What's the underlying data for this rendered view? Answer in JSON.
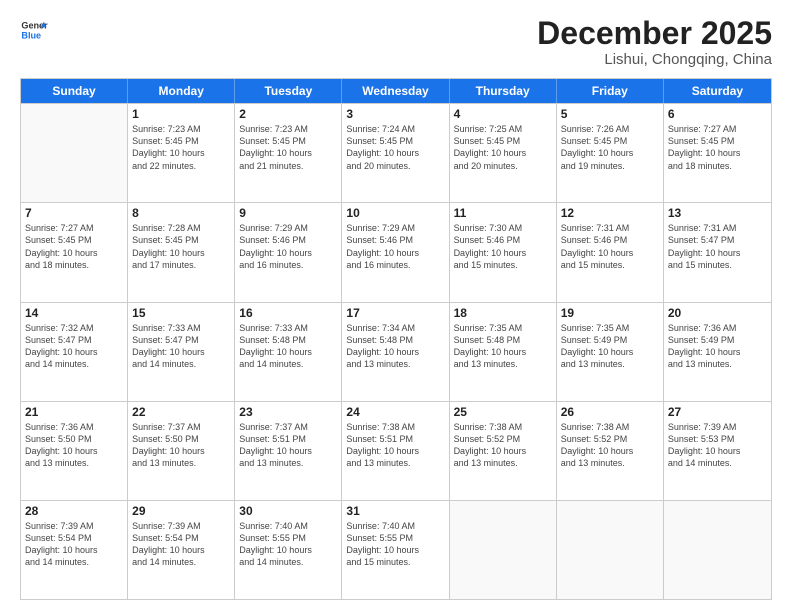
{
  "header": {
    "logo_general": "General",
    "logo_blue": "Blue",
    "month": "December 2025",
    "location": "Lishui, Chongqing, China"
  },
  "weekdays": [
    "Sunday",
    "Monday",
    "Tuesday",
    "Wednesday",
    "Thursday",
    "Friday",
    "Saturday"
  ],
  "rows": [
    [
      {
        "day": "",
        "empty": true
      },
      {
        "day": "1",
        "rise": "7:23 AM",
        "set": "5:45 PM",
        "daylight": "10 hours and 22 minutes."
      },
      {
        "day": "2",
        "rise": "7:23 AM",
        "set": "5:45 PM",
        "daylight": "10 hours and 21 minutes."
      },
      {
        "day": "3",
        "rise": "7:24 AM",
        "set": "5:45 PM",
        "daylight": "10 hours and 20 minutes."
      },
      {
        "day": "4",
        "rise": "7:25 AM",
        "set": "5:45 PM",
        "daylight": "10 hours and 20 minutes."
      },
      {
        "day": "5",
        "rise": "7:26 AM",
        "set": "5:45 PM",
        "daylight": "10 hours and 19 minutes."
      },
      {
        "day": "6",
        "rise": "7:27 AM",
        "set": "5:45 PM",
        "daylight": "10 hours and 18 minutes."
      }
    ],
    [
      {
        "day": "7",
        "rise": "7:27 AM",
        "set": "5:45 PM",
        "daylight": "10 hours and 18 minutes."
      },
      {
        "day": "8",
        "rise": "7:28 AM",
        "set": "5:45 PM",
        "daylight": "10 hours and 17 minutes."
      },
      {
        "day": "9",
        "rise": "7:29 AM",
        "set": "5:46 PM",
        "daylight": "10 hours and 16 minutes."
      },
      {
        "day": "10",
        "rise": "7:29 AM",
        "set": "5:46 PM",
        "daylight": "10 hours and 16 minutes."
      },
      {
        "day": "11",
        "rise": "7:30 AM",
        "set": "5:46 PM",
        "daylight": "10 hours and 15 minutes."
      },
      {
        "day": "12",
        "rise": "7:31 AM",
        "set": "5:46 PM",
        "daylight": "10 hours and 15 minutes."
      },
      {
        "day": "13",
        "rise": "7:31 AM",
        "set": "5:47 PM",
        "daylight": "10 hours and 15 minutes."
      }
    ],
    [
      {
        "day": "14",
        "rise": "7:32 AM",
        "set": "5:47 PM",
        "daylight": "10 hours and 14 minutes."
      },
      {
        "day": "15",
        "rise": "7:33 AM",
        "set": "5:47 PM",
        "daylight": "10 hours and 14 minutes."
      },
      {
        "day": "16",
        "rise": "7:33 AM",
        "set": "5:48 PM",
        "daylight": "10 hours and 14 minutes."
      },
      {
        "day": "17",
        "rise": "7:34 AM",
        "set": "5:48 PM",
        "daylight": "10 hours and 13 minutes."
      },
      {
        "day": "18",
        "rise": "7:35 AM",
        "set": "5:48 PM",
        "daylight": "10 hours and 13 minutes."
      },
      {
        "day": "19",
        "rise": "7:35 AM",
        "set": "5:49 PM",
        "daylight": "10 hours and 13 minutes."
      },
      {
        "day": "20",
        "rise": "7:36 AM",
        "set": "5:49 PM",
        "daylight": "10 hours and 13 minutes."
      }
    ],
    [
      {
        "day": "21",
        "rise": "7:36 AM",
        "set": "5:50 PM",
        "daylight": "10 hours and 13 minutes."
      },
      {
        "day": "22",
        "rise": "7:37 AM",
        "set": "5:50 PM",
        "daylight": "10 hours and 13 minutes."
      },
      {
        "day": "23",
        "rise": "7:37 AM",
        "set": "5:51 PM",
        "daylight": "10 hours and 13 minutes."
      },
      {
        "day": "24",
        "rise": "7:38 AM",
        "set": "5:51 PM",
        "daylight": "10 hours and 13 minutes."
      },
      {
        "day": "25",
        "rise": "7:38 AM",
        "set": "5:52 PM",
        "daylight": "10 hours and 13 minutes."
      },
      {
        "day": "26",
        "rise": "7:38 AM",
        "set": "5:52 PM",
        "daylight": "10 hours and 13 minutes."
      },
      {
        "day": "27",
        "rise": "7:39 AM",
        "set": "5:53 PM",
        "daylight": "10 hours and 14 minutes."
      }
    ],
    [
      {
        "day": "28",
        "rise": "7:39 AM",
        "set": "5:54 PM",
        "daylight": "10 hours and 14 minutes."
      },
      {
        "day": "29",
        "rise": "7:39 AM",
        "set": "5:54 PM",
        "daylight": "10 hours and 14 minutes."
      },
      {
        "day": "30",
        "rise": "7:40 AM",
        "set": "5:55 PM",
        "daylight": "10 hours and 14 minutes."
      },
      {
        "day": "31",
        "rise": "7:40 AM",
        "set": "5:55 PM",
        "daylight": "10 hours and 15 minutes."
      },
      {
        "day": "",
        "empty": true
      },
      {
        "day": "",
        "empty": true
      },
      {
        "day": "",
        "empty": true
      }
    ]
  ],
  "labels": {
    "sunrise": "Sunrise:",
    "sunset": "Sunset:",
    "daylight": "Daylight:"
  }
}
